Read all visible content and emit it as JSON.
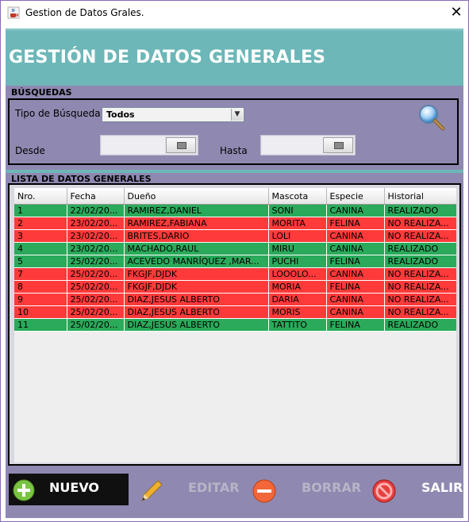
{
  "window": {
    "title": "Gestion de Datos Grales.",
    "close_glyph": "✕"
  },
  "header": {
    "title": "GESTIÓN DE DATOS GENERALES"
  },
  "search": {
    "section_label": "BÚSQUEDAS",
    "tipo_label": "Tipo de Búsqueda",
    "tipo_value": "Todos",
    "desde_label": "Desde",
    "hasta_label": "Hasta",
    "search_icon": "magnifier-icon"
  },
  "list": {
    "section_label": "LISTA DE DATOS GENERALES",
    "columns": [
      "Nro.",
      "Fecha",
      "Dueño",
      "Mascota",
      "Especie",
      "Historial"
    ],
    "rows": [
      {
        "status": "green",
        "cells": [
          "1",
          "22/02/20...",
          "RAMIREZ,DANIEL",
          "SONI",
          "CANINA",
          "REALIZADO"
        ]
      },
      {
        "status": "red",
        "cells": [
          "2",
          "23/02/20...",
          "RAMIREZ,FABIANA",
          "MORITA",
          "FELINA",
          "NO REALIZA..."
        ]
      },
      {
        "status": "red",
        "cells": [
          "3",
          "23/02/20...",
          "BRITES,DARIO",
          "LOLI",
          "CANINA",
          "NO REALIZA..."
        ]
      },
      {
        "status": "green",
        "cells": [
          "4",
          "23/02/20...",
          "MACHADO,RAUL",
          "MIRU",
          "CANINA",
          "REALIZADO"
        ]
      },
      {
        "status": "green",
        "cells": [
          "5",
          "25/02/20...",
          "ACEVEDO MANRÍQUEZ ,MAR...",
          "PUCHI",
          "FELINA",
          "REALIZADO"
        ]
      },
      {
        "status": "red",
        "cells": [
          "7",
          "25/02/20...",
          "FKGJF,DJDK",
          "LOOOLO...",
          "CANINA",
          "NO REALIZA..."
        ]
      },
      {
        "status": "red",
        "cells": [
          "8",
          "25/02/20...",
          "FKGJF,DJDK",
          "MORIA",
          "FELINA",
          "NO REALIZA..."
        ]
      },
      {
        "status": "red",
        "cells": [
          "9",
          "25/02/20...",
          "DIAZ,JESUS ALBERTO",
          "DARIA",
          "CANINA",
          "NO REALIZA..."
        ]
      },
      {
        "status": "red",
        "cells": [
          "10",
          "25/02/20...",
          "DIAZ,JESUS ALBERTO",
          "MORIS",
          "CANINA",
          "NO REALIZA..."
        ]
      },
      {
        "status": "green",
        "cells": [
          "11",
          "25/02/20...",
          "DIAZ,JESUS ALBERTO",
          "TATTITO",
          "FELINA",
          "REALIZADO"
        ]
      }
    ]
  },
  "toolbar": {
    "nuevo": "NUEVO",
    "editar": "EDITAR",
    "borrar": "BORRAR",
    "salir": "SALIR"
  },
  "colors": {
    "realizado": "#2aaa5a",
    "no_realizado": "#ff3a3a",
    "header_bg": "#6db7b8",
    "panel_bg": "#8f88b0"
  }
}
